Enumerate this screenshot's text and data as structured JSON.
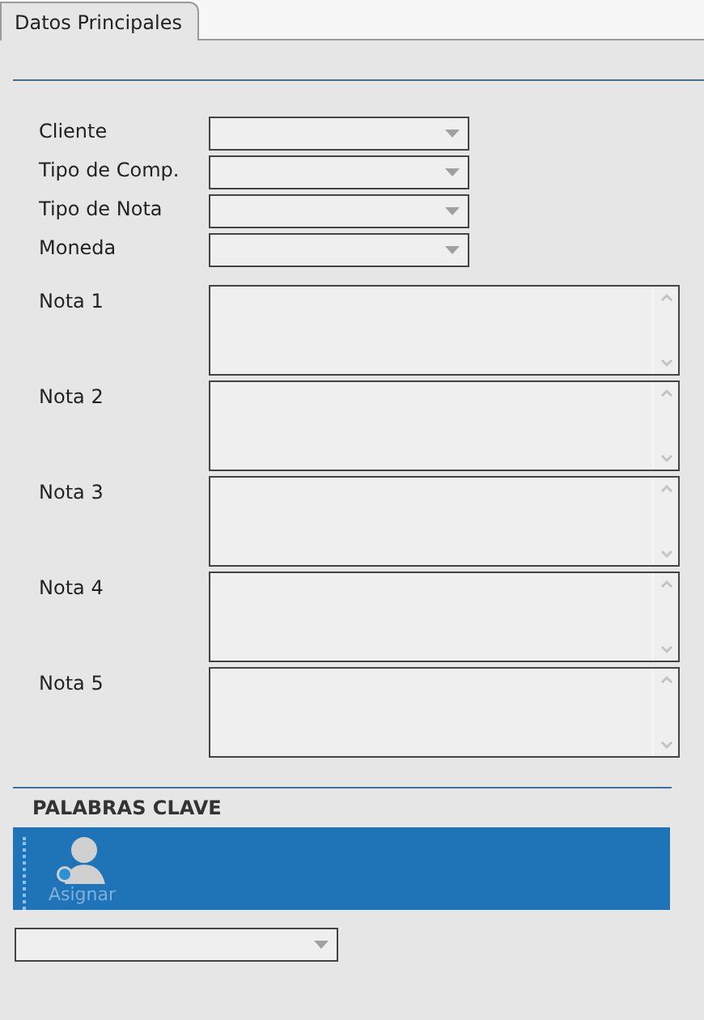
{
  "tabs": [
    {
      "label": "Datos Principales",
      "selected": true
    }
  ],
  "fields": [
    {
      "label": "Cliente",
      "kind": "combo"
    },
    {
      "label": "Tipo de Comp.",
      "kind": "combo"
    },
    {
      "label": "Tipo de Nota",
      "kind": "combo"
    },
    {
      "label": "Moneda",
      "kind": "combo"
    },
    {
      "label": "Nota 1",
      "kind": "textarea"
    },
    {
      "label": "Nota 2",
      "kind": "textarea"
    },
    {
      "label": "Nota 3",
      "kind": "textarea"
    },
    {
      "label": "Nota 4",
      "kind": "textarea"
    },
    {
      "label": "Nota 5",
      "kind": "textarea"
    }
  ],
  "keywords": {
    "title": "PALABRAS CLAVE",
    "toolbar": [
      {
        "label": "Asignar",
        "disabled": true
      }
    ]
  }
}
